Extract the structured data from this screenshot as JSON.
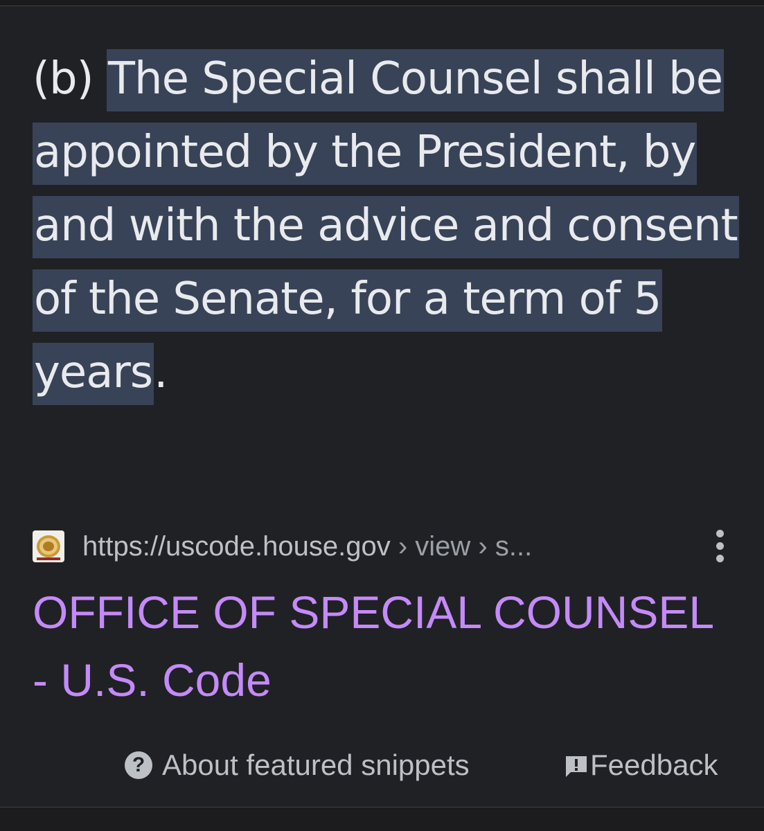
{
  "snippet": {
    "prefix": "(b) ",
    "highlighted": "The Special Counsel shall be appointed by the President, by and with the advice and consent of the Senate, for a term of 5 years",
    "suffix": "."
  },
  "source": {
    "favicon": "us-house-seal-icon",
    "url": "https://uscode.house.gov",
    "breadcrumb": " › view › s...",
    "menu_icon": "more-vert-icon"
  },
  "result": {
    "title": "OFFICE OF SPECIAL COUNSEL - U.S. Code",
    "title_color": "#c58af9"
  },
  "footer": {
    "about_label": "About featured snippets",
    "about_icon": "help-circle-icon",
    "feedback_label": "Feedback",
    "feedback_icon": "feedback-icon"
  },
  "colors": {
    "background": "#202124",
    "highlight": "#394357",
    "text": "#e8eaed",
    "secondary_text": "#bdc1c6"
  }
}
